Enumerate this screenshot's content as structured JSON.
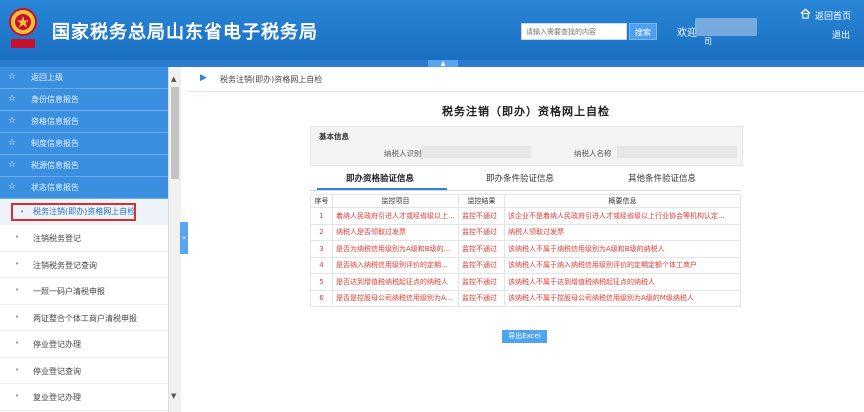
{
  "header": {
    "brand": "国家税务总局山东省电子税务局",
    "search_placeholder": "请输入需要查找的内容",
    "search_button": "搜索",
    "welcome": "欢迎",
    "username_tail": "司",
    "home_link": "返回首页",
    "logout": "退出",
    "collapse_glyph": "▲"
  },
  "sidebar": {
    "groups": [
      {
        "label": "返回上级"
      },
      {
        "label": "身份信息报告"
      },
      {
        "label": "资格信息报告"
      },
      {
        "label": "制度信息报告"
      },
      {
        "label": "税源信息报告"
      },
      {
        "label": "状态信息报告"
      }
    ],
    "active_item": "税务注销(即办)资格网上自检",
    "items": [
      {
        "label": "注销税务登记"
      },
      {
        "label": "注销税务登记查询"
      },
      {
        "label": "一照一码户清税申报"
      },
      {
        "label": "两证整合个体工商户清税申报"
      },
      {
        "label": "停业登记办理"
      },
      {
        "label": "停业登记查询"
      },
      {
        "label": "复业登记办理"
      }
    ],
    "toggle_glyph": "«"
  },
  "breadcrumb": {
    "text": "税务注销(即办)资格网上自检"
  },
  "page": {
    "title": "税务注销（即办）资格网上自检",
    "basic_info": {
      "heading": "基本信息",
      "taxpayer_id_label": "纳税人识别号",
      "taxpayer_name_label": "纳税人名称"
    },
    "tabs": [
      {
        "label": "即办资格验证信息",
        "active": true
      },
      {
        "label": "即办条件验证信息",
        "active": false
      },
      {
        "label": "其他条件验证信息",
        "active": false
      }
    ],
    "table": {
      "headers": [
        "序号",
        "监控项目",
        "监控结果",
        "概要信息"
      ],
      "rows": [
        [
          "1",
          "着纳人民政府引进人才或经省级以上...",
          "监控不通过",
          "该企业不是着纳人民政府引进人才或经省级以上行业协会等机构认定..."
        ],
        [
          "2",
          "纳税人是否领取过发票",
          "监控不通过",
          "纳税人领取过发票"
        ],
        [
          "3",
          "是否为纳税信用级别为A级和B级的...",
          "监控不通过",
          "该纳税人不属于纳税信用级别为A级和B级的纳税人"
        ],
        [
          "4",
          "是否纳入纳税信用级别评价的定期...",
          "监控不通过",
          "该纳税人不属于纳入纳税信用级别评价的定期定额个体工商户"
        ],
        [
          "5",
          "是否达到增值税纳税起征点的纳税人",
          "监控不通过",
          "该纳税人不属于达到增值税纳税起征点的纳税人"
        ],
        [
          "6",
          "是否是控股母公司纳税信用级别为A...",
          "监控不通过",
          "该纳税人不属于控股母公司纳税信用级别为A级的M级纳税人"
        ]
      ]
    },
    "export_button": "导出Excel"
  },
  "colors": {
    "header_blue": "#1f79cc",
    "sidebar_blue": "#3b8fe0",
    "alert_red": "#e23b33",
    "highlight_box": "#d9322d"
  }
}
